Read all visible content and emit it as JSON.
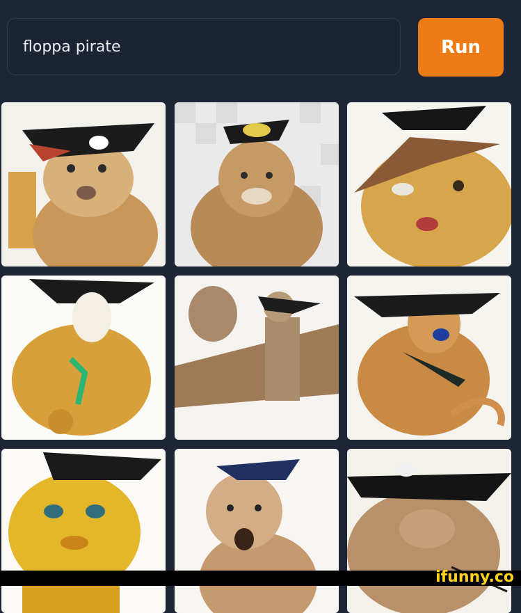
{
  "search": {
    "query": "floppa pirate"
  },
  "run_button": {
    "label": "Run"
  },
  "images": [
    {
      "subject": "pirate-floppa-1"
    },
    {
      "subject": "pirate-floppa-2"
    },
    {
      "subject": "pirate-floppa-3"
    },
    {
      "subject": "pirate-floppa-4"
    },
    {
      "subject": "pirate-floppa-5"
    },
    {
      "subject": "pirate-floppa-6"
    },
    {
      "subject": "pirate-floppa-7"
    },
    {
      "subject": "pirate-floppa-8"
    },
    {
      "subject": "pirate-floppa-9"
    }
  ],
  "watermark": "ifunny.co",
  "colors": {
    "background": "#1e2535",
    "accent": "#ee7c16"
  }
}
